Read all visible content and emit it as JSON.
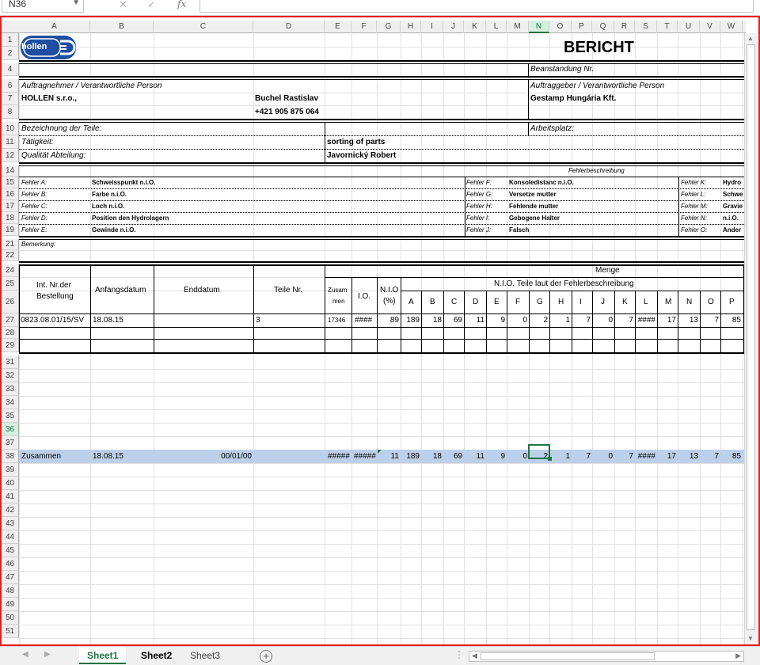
{
  "formula_bar": {
    "name_box": "N36",
    "fx_label": "fx",
    "formula": ""
  },
  "columns": [
    "A",
    "B",
    "C",
    "D",
    "E",
    "F",
    "G",
    "H",
    "I",
    "J",
    "K",
    "L",
    "M",
    "N",
    "O",
    "P",
    "Q",
    "R",
    "S",
    "T",
    "U",
    "V",
    "W"
  ],
  "rows_visible": [
    "1",
    "2",
    "4",
    "6",
    "7",
    "8",
    "10",
    "11",
    "12",
    "14",
    "15",
    "16",
    "17",
    "18",
    "19",
    "21",
    "22",
    "24",
    "25",
    "26",
    "27",
    "28",
    "29",
    "31",
    "32",
    "33",
    "34",
    "35",
    "36",
    "37",
    "38",
    "39",
    "40",
    "41",
    "42",
    "43",
    "44",
    "45",
    "46",
    "47",
    "48",
    "49",
    "50",
    "51"
  ],
  "selected": {
    "column": "N",
    "row": "36"
  },
  "report": {
    "logo_text": "hollen",
    "title": "BERICHT",
    "beanstandung_label": "Beanstandung Nr.",
    "contractor_label": "Auftragnehmer / Verantwortliche Person",
    "client_label": "Auftraggeber / Verantwortliche Person",
    "contractor_name": "HOLLEN s.r.o.,",
    "contractor_person": "Buchel Rastislav",
    "contractor_phone": "+421 905 875 064",
    "client_name": "Gestamp Hungária Kft.",
    "bezeichnung_label": "Bezeichnung der Teile:",
    "arbeitsplatz_label": "Arbeitsplatz:",
    "taetigkeit_label": "Tätigkeit:",
    "taetigkeit_value": "sorting of parts",
    "qualitaet_label": "Qualität Abteilung:",
    "qualitaet_value": "Javornický Robert",
    "fehler_header": "Fehlerbeschreibung",
    "fehler_col1": [
      {
        "label": "Fehler A:",
        "value": "Schweisspunkt n.i.O."
      },
      {
        "label": "Fehler B:",
        "value": "Farbe n.i.O."
      },
      {
        "label": "Fehler C:",
        "value": "Loch n.i.O."
      },
      {
        "label": "Fehler D:",
        "value": "Position den Hydrolagern"
      },
      {
        "label": "Fehler E:",
        "value": "Gewinde n.i.O."
      }
    ],
    "fehler_col2": [
      {
        "label": "Fehler F:",
        "value": "Konsoledistanc n.i.O."
      },
      {
        "label": "Fehler G:",
        "value": "Versetze mutter"
      },
      {
        "label": "Fehler H:",
        "value": "Fehlende mutter"
      },
      {
        "label": "Fehler I:",
        "value": "Gebogene Halter"
      },
      {
        "label": "Fehler J:",
        "value": "Falsch"
      }
    ],
    "fehler_col3": [
      {
        "label": "Fehler K:",
        "value": "Hydro"
      },
      {
        "label": "Fehler L:",
        "value": "Schwe"
      },
      {
        "label": "Fehler M:",
        "value": "Gravie"
      },
      {
        "label": "Fehler N:",
        "value": "n.i.O."
      },
      {
        "label": "Fehler O:",
        "value": "Ander"
      }
    ],
    "bemerkung_label": "Bemerkung:",
    "table": {
      "menge_header": "Menge",
      "nio_group_header": "N.I.O. Teile laut der Fehlerbeschreibung",
      "col_int_nr_1": "Int. Nr.der",
      "col_int_nr_2": "Bestellung",
      "col_anfang": "Anfangsdatum",
      "col_end": "Enddatum",
      "col_teile": "Teile Nr.",
      "col_zusammen_1": "Zusam",
      "col_zusammen_2": "men",
      "col_io": "I.O.",
      "col_nio_1": "N.I.O",
      "col_nio_2": "(%)",
      "defect_letters": [
        "A",
        "B",
        "C",
        "D",
        "E",
        "F",
        "G",
        "H",
        "I",
        "J",
        "K",
        "L",
        "M",
        "N",
        "O",
        "P"
      ],
      "row27": {
        "int_nr": "0823.08.01/15/SV",
        "anfang": "18.08.15",
        "teile": "3",
        "zusammen": "17346",
        "io": "####",
        "nio": "89",
        "defects": [
          "189",
          "18",
          "69",
          "11",
          "9",
          "0",
          "2",
          "1",
          "7",
          "0",
          "7",
          "####",
          "17",
          "13",
          "7",
          "85"
        ]
      },
      "total": {
        "label": "Zusammen",
        "anfang": "18.08.15",
        "end": "00/01/00",
        "zusammen": "#####",
        "io": "#####",
        "nio": "11",
        "defects": [
          "189",
          "18",
          "69",
          "11",
          "9",
          "0",
          "2",
          "1",
          "7",
          "0",
          "7",
          "####",
          "17",
          "13",
          "7",
          "85"
        ]
      }
    }
  },
  "sheets": [
    {
      "name": "Sheet1",
      "active": true
    },
    {
      "name": "Sheet2",
      "active": false
    },
    {
      "name": "Sheet3",
      "active": false
    }
  ],
  "colors": {
    "accent": "#217346",
    "selection_border": "#e81c1c",
    "total_row": "#bdd0e9"
  }
}
